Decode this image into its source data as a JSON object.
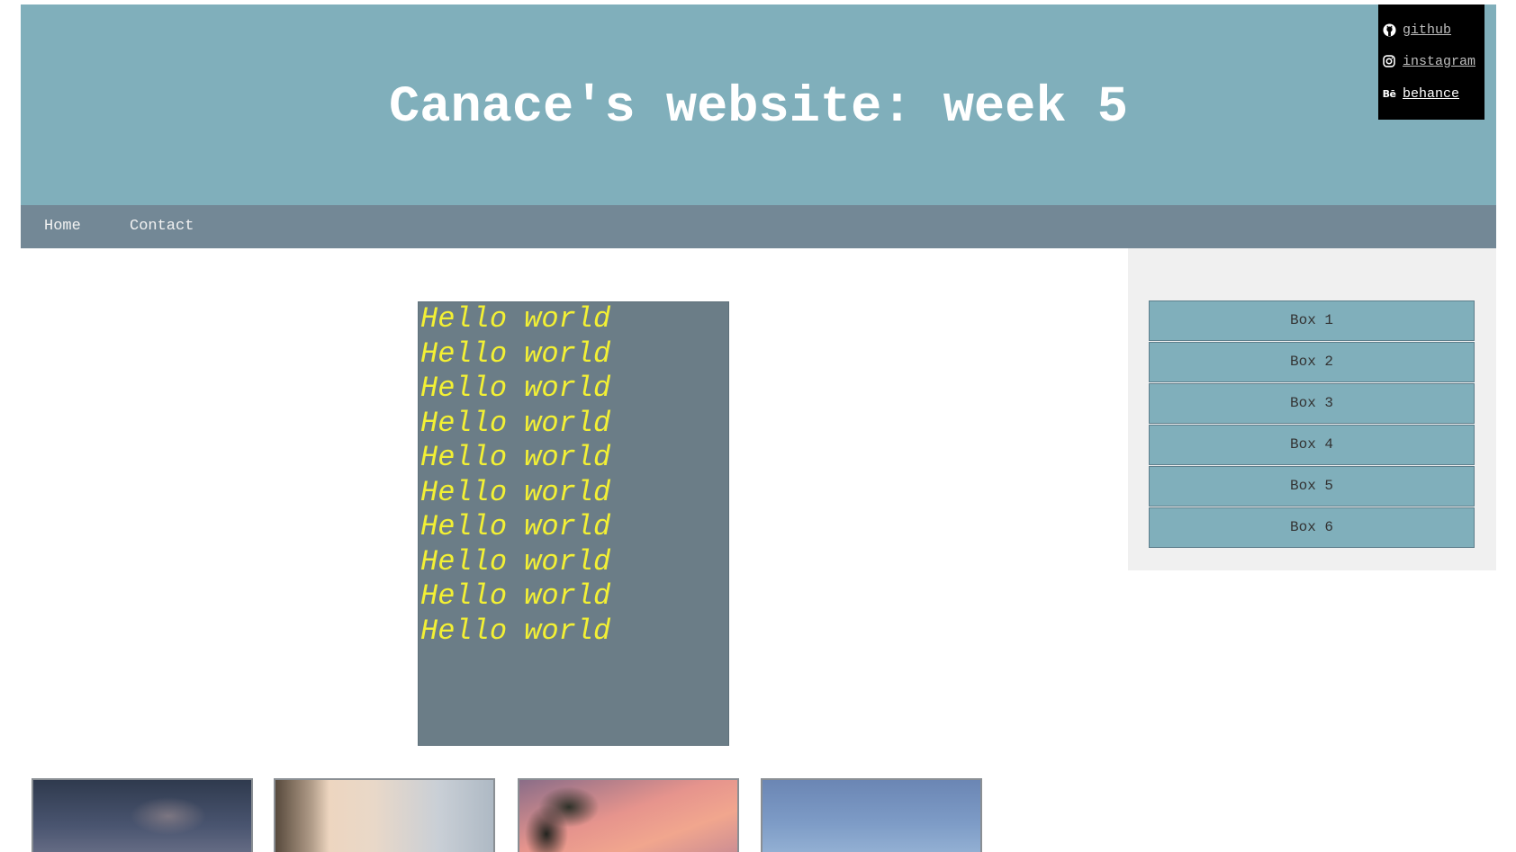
{
  "header": {
    "title": "Canace's website: week 5"
  },
  "social": [
    {
      "icon": "github-icon",
      "label": "github"
    },
    {
      "icon": "instagram-icon",
      "label": "instagram"
    },
    {
      "icon": "behance-icon",
      "label": "behance"
    }
  ],
  "nav": {
    "items": [
      {
        "label": "Home"
      },
      {
        "label": "Contact"
      }
    ]
  },
  "main": {
    "hello_lines": [
      "Hello world",
      "Hello world",
      "Hello world",
      "Hello world",
      "Hello world",
      "Hello world",
      "Hello world",
      "Hello world",
      "Hello world",
      "Hello world"
    ]
  },
  "sidebar": {
    "boxes": [
      {
        "label": "Box 1"
      },
      {
        "label": "Box 2"
      },
      {
        "label": "Box 3"
      },
      {
        "label": "Box 4"
      },
      {
        "label": "Box 5"
      },
      {
        "label": "Box 6"
      }
    ]
  },
  "colors": {
    "header_bg": "#80afbb",
    "nav_bg": "#738896",
    "hello_bg": "#6b7d87",
    "hello_text": "#f3f034",
    "sidebar_bg": "#f0f0f0",
    "social_bg": "#000000"
  }
}
